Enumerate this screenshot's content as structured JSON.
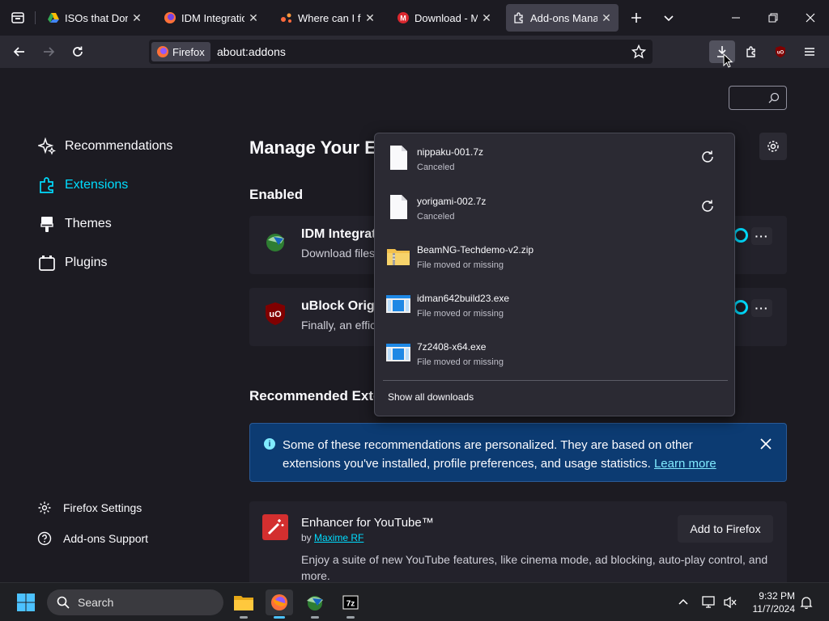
{
  "tabs": [
    {
      "title": "ISOs that Don't l",
      "icon": "google-drive-icon"
    },
    {
      "title": "IDM Integration",
      "icon": "firefox-icon"
    },
    {
      "title": "Where can I find",
      "icon": "forum-icon"
    },
    {
      "title": "Download - ME",
      "icon": "mega-icon"
    },
    {
      "title": "Add-ons Manag",
      "icon": "puzzle-icon",
      "active": true
    }
  ],
  "urlbar": {
    "identity": "Firefox",
    "url": "about:addons"
  },
  "sidebar": {
    "categories": [
      {
        "label": "Recommendations",
        "icon": "sparkle-icon"
      },
      {
        "label": "Extensions",
        "icon": "puzzle-icon",
        "selected": true
      },
      {
        "label": "Themes",
        "icon": "brush-icon"
      },
      {
        "label": "Plugins",
        "icon": "plugin-icon"
      }
    ],
    "footer": [
      {
        "label": "Firefox Settings",
        "icon": "gear-icon"
      },
      {
        "label": "Add-ons Support",
        "icon": "help-icon"
      }
    ]
  },
  "main": {
    "title": "Manage Your Ex",
    "enabled_heading": "Enabled",
    "extensions": [
      {
        "name": "IDM Integrat",
        "desc": "Download files"
      },
      {
        "name": "uBlock Origi",
        "desc": "Finally, an effic"
      }
    ],
    "recommended_heading": "Recommended Extensions",
    "info": {
      "text": "Some of these recommendations are personalized. They are based on other extensions you've installed, profile preferences, and usage statistics.",
      "link": "Learn more"
    },
    "recommended": {
      "name": "Enhancer for YouTube™",
      "by_prefix": "by",
      "author": "Maxime RF",
      "desc": "Enjoy a suite of new YouTube features, like cinema mode, ad blocking, auto-play control, and more.",
      "add_label": "Add to Firefox"
    }
  },
  "downloads": {
    "items": [
      {
        "name": "nippaku-001.7z",
        "status": "Canceled",
        "type": "blank",
        "retry": true
      },
      {
        "name": "yorigami-002.7z",
        "status": "Canceled",
        "type": "blank",
        "retry": true
      },
      {
        "name": "BeamNG-Techdemo-v2.zip",
        "status": "File moved or missing",
        "type": "zip",
        "retry": false
      },
      {
        "name": "idman642build23.exe",
        "status": "File moved or missing",
        "type": "exe",
        "retry": false
      },
      {
        "name": "7z2408-x64.exe",
        "status": "File moved or missing",
        "type": "exe",
        "retry": false
      }
    ],
    "show_all": "Show all downloads"
  },
  "taskbar": {
    "search": "Search",
    "time": "9:32 PM",
    "date": "11/7/2024"
  },
  "colors": {
    "accent": "#00ddff",
    "info_bg": "#0c3b72",
    "panel_bg": "#2b2a33",
    "page_bg": "#1c1b22"
  }
}
